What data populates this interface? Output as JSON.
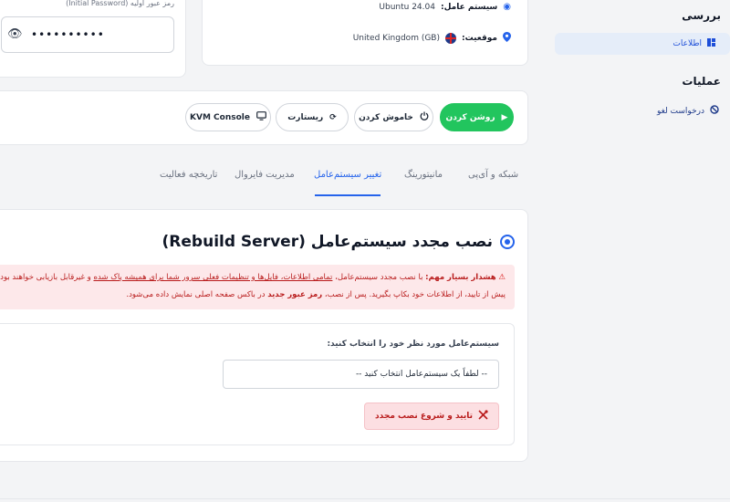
{
  "password": {
    "label": "رمز عبور اولیه (Initial Password)",
    "value": "••••••••••",
    "show_icon": "eye-icon"
  },
  "server_info": {
    "os_label": "سیستم عامل:",
    "os_value": "Ubuntu 24.04",
    "location_label": "موقعیت:",
    "location_value": "United Kingdom (GB)",
    "os_icon": "circle-icon",
    "location_icon": "location-pin-icon"
  },
  "sidebar": {
    "review_heading": "بررسی",
    "info_item": "اطلاعات",
    "operations_heading": "عملیات",
    "cancel_request": "درخواست لغو"
  },
  "actions": {
    "power_on": "روشن کردن",
    "power_off": "خاموش کردن",
    "restart": "ریستارت",
    "kvm": "KVM Console"
  },
  "tabs": {
    "network": "شبکه و آی‌پی",
    "monitoring": "مانیتورینگ",
    "change_os": "تغییر سیستم‌عامل",
    "firewall": "مدیریت فایروال",
    "activity": "تاریخچه فعالیت",
    "active": "change_os"
  },
  "rebuild": {
    "title": "نصب مجدد سیستم‌عامل (Rebuild Server)",
    "warning_strong": "هشدار بسیار مهم:",
    "warning_text_a": "با نصب مجدد سیستم‌عامل،",
    "warning_underlined": "تمامی اطلاعات، فایل‌ها و تنظیمات فعلی سرور شما برای همیشه پاک شده",
    "warning_text_b": "و غیرقابل بازیابی خواهند بود. لط",
    "warning_line2_a": "پیش از تایید، از اطلاعات خود بکاپ بگیرید. پس از نصب،",
    "warning_line2_strong": "رمز عبور جدید",
    "warning_line2_b": "در باکس صفحه اصلی نمایش داده می‌شود.",
    "select_label": "سیستم‌عامل مورد نظر خود را انتخاب کنید:",
    "select_placeholder": "-- لطفاً یک سیستم‌عامل انتخاب کنید --",
    "confirm_button": "تایید و شروع نصب مجدد"
  },
  "colors": {
    "primary": "#2563eb",
    "success": "#22c55e",
    "danger": "#b91c1c",
    "danger_bg": "#fde8ea"
  }
}
